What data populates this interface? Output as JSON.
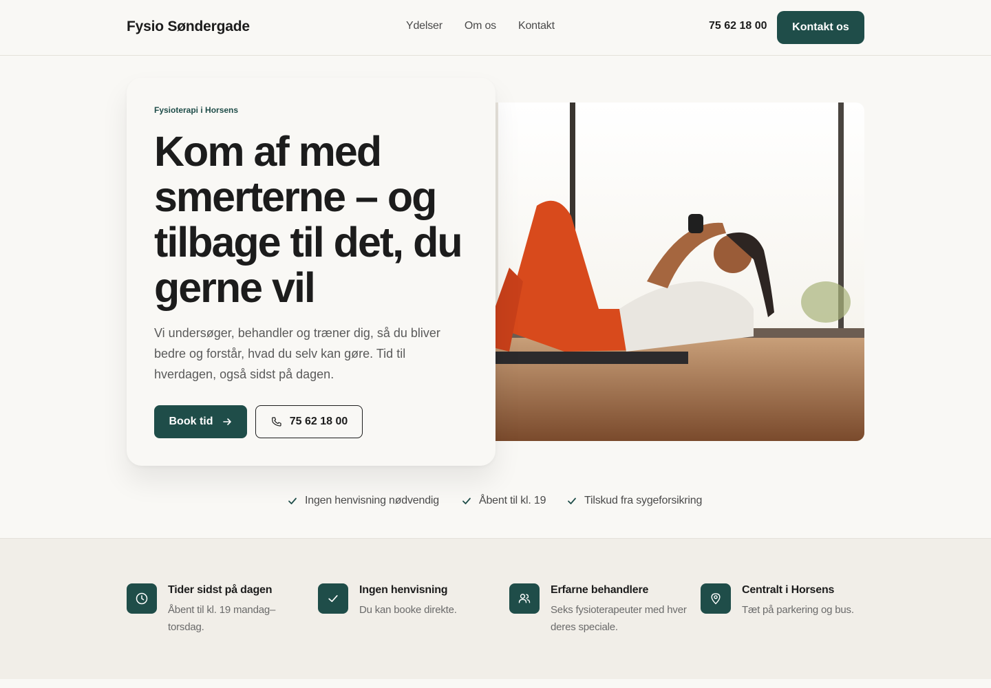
{
  "header": {
    "brand": "Fysio Søndergade",
    "nav": [
      "Ydelser",
      "Om os",
      "Kontakt"
    ],
    "phone": "75 62 18 00",
    "cta_label": "Kontakt os"
  },
  "hero": {
    "eyebrow": "Fysioterapi i Horsens",
    "headline": "Kom af med smerterne – og tilbage til det, du gerne vil",
    "lead": "Vi undersøger, behandler og træner dig, så du bliver bedre og forstår, hvad du selv kan gøre. Tid til hverdagen, også sidst på dagen.",
    "book_label": "Book tid",
    "phone_label": "75 62 18 00",
    "photo_icon": "woman-doing-situps-photo"
  },
  "trust": [
    "Ingen henvisning nødvendig",
    "Åbent til kl. 19",
    "Tilskud fra sygeforsikring"
  ],
  "features": [
    {
      "icon": "clock-icon",
      "title": "Tider sidst på dagen",
      "desc": "Åbent til kl. 19 mandag–torsdag."
    },
    {
      "icon": "check-icon",
      "title": "Ingen henvisning",
      "desc": "Du kan booke direkte."
    },
    {
      "icon": "users-icon",
      "title": "Erfarne behandlere",
      "desc": "Seks fysioterapeuter med hver deres speciale."
    },
    {
      "icon": "map-pin-icon",
      "title": "Centralt i Horsens",
      "desc": "Tæt på parkering og bus."
    }
  ],
  "colors": {
    "accent": "#1f4d49",
    "background": "#f9f8f5",
    "feature_band": "#f1eee8"
  }
}
